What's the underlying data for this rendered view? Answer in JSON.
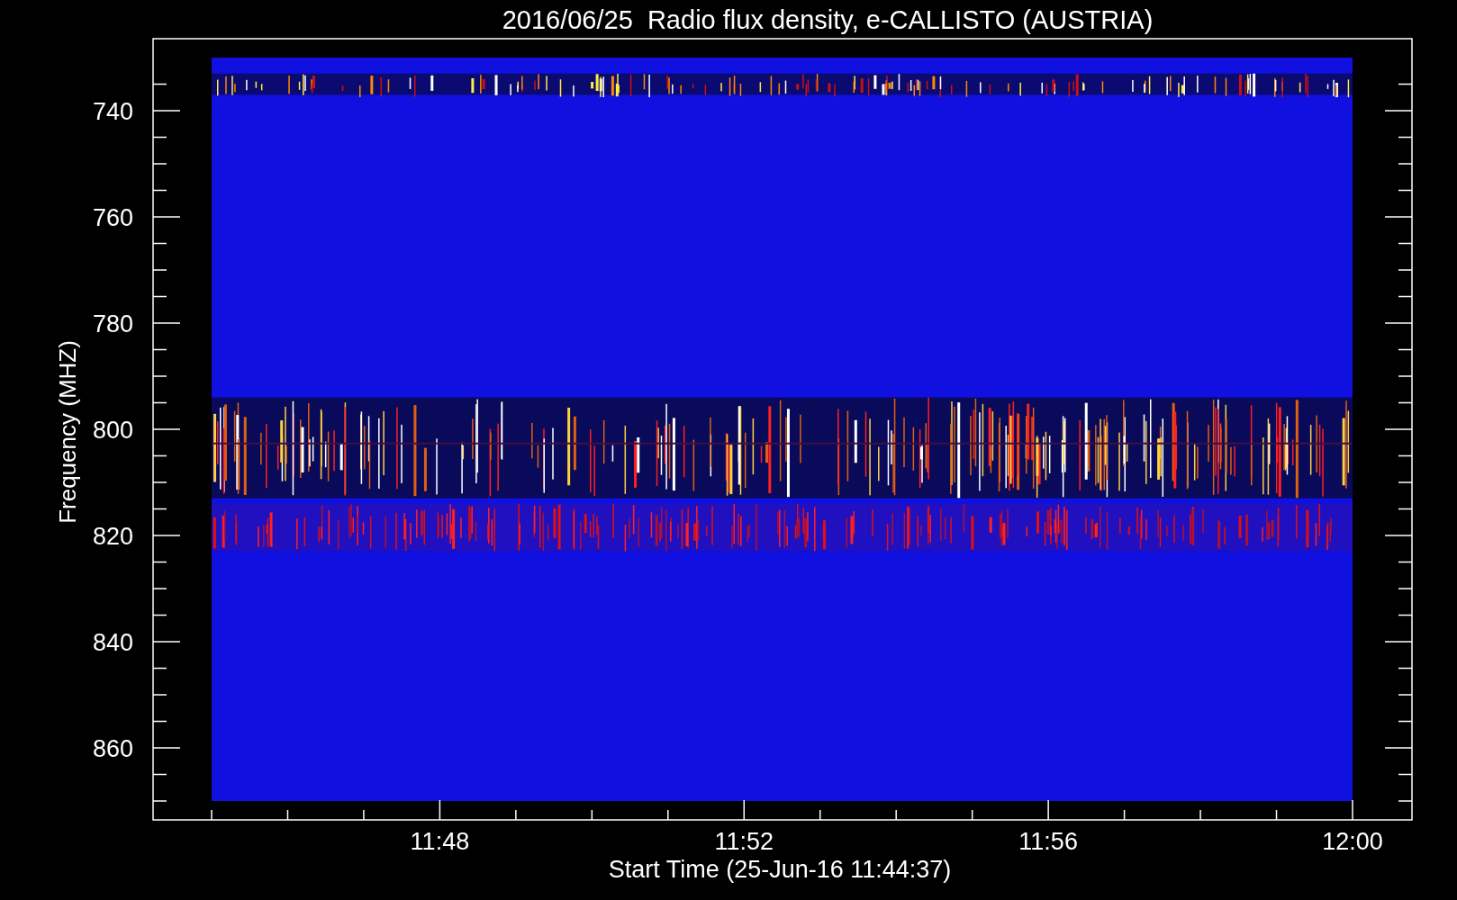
{
  "title": "2016/06/25  Radio flux density, e-CALLISTO (AUSTRIA)",
  "y_axis": {
    "label": "Frequency (MHZ)",
    "ticks": [
      "740",
      "760",
      "780",
      "800",
      "820",
      "840",
      "860"
    ]
  },
  "x_axis": {
    "label": "Start Time (25-Jun-16 11:44:37)",
    "ticks": [
      "11:48",
      "11:52",
      "11:56",
      "12:00"
    ]
  }
}
